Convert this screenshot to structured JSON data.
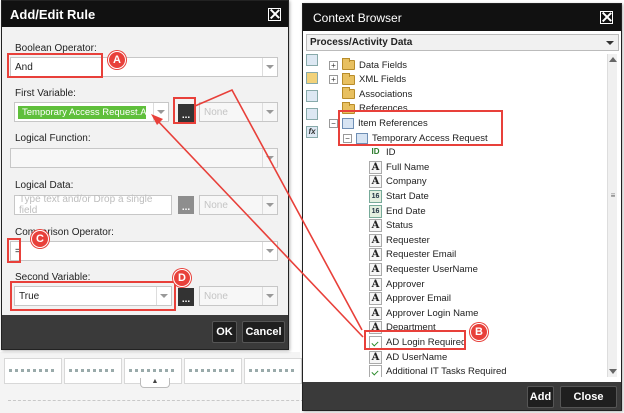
{
  "rule_dialog": {
    "title": "Add/Edit Rule",
    "boolean_operator": {
      "label": "Boolean Operator:",
      "value": "And"
    },
    "first_variable": {
      "label": "First Variable:",
      "value": "Temporary Access Request.AD L",
      "dots": "...",
      "type_value": "None"
    },
    "logical_function": {
      "label": "Logical Function:",
      "value": ""
    },
    "logical_data": {
      "label": "Logical Data:",
      "placeholder": "Type text and/or Drop a single field",
      "dots": "...",
      "type_value": "None"
    },
    "comparison_operator": {
      "label": "Comparison Operator:",
      "value": "="
    },
    "second_variable": {
      "label": "Second Variable:",
      "value": "True",
      "dots": "...",
      "type_value": "None"
    },
    "ok_label": "OK",
    "cancel_label": "Cancel"
  },
  "context_browser": {
    "title": "Context Browser",
    "dropdown_value": "Process/Activity Data",
    "tree": [
      {
        "label": "Data Fields",
        "icon": "folder-icon",
        "expander": "+"
      },
      {
        "label": "XML Fields",
        "icon": "folder-icon",
        "expander": "+"
      },
      {
        "label": "Associations",
        "icon": "folder-icon",
        "expander": ""
      },
      {
        "label": "References",
        "icon": "folder-icon",
        "expander": ""
      },
      {
        "label": "Item References",
        "icon": "item-references-icon",
        "expander": "−"
      },
      {
        "label": "Temporary Access Request",
        "icon": "object-icon",
        "expander": "−"
      },
      {
        "label": "ID",
        "icon": "id-field-icon",
        "expander": ""
      },
      {
        "label": "Full Name",
        "icon": "text-field-icon",
        "expander": ""
      },
      {
        "label": "Company",
        "icon": "text-field-icon",
        "expander": ""
      },
      {
        "label": "Start Date",
        "icon": "date-field-icon",
        "expander": ""
      },
      {
        "label": "End Date",
        "icon": "date-field-icon",
        "expander": ""
      },
      {
        "label": "Status",
        "icon": "text-field-icon",
        "expander": ""
      },
      {
        "label": "Requester",
        "icon": "text-field-icon",
        "expander": ""
      },
      {
        "label": "Requester Email",
        "icon": "text-field-icon",
        "expander": ""
      },
      {
        "label": "Requester UserName",
        "icon": "text-field-icon",
        "expander": ""
      },
      {
        "label": "Approver",
        "icon": "text-field-icon",
        "expander": ""
      },
      {
        "label": "Approver Email",
        "icon": "text-field-icon",
        "expander": ""
      },
      {
        "label": "Approver Login Name",
        "icon": "text-field-icon",
        "expander": ""
      },
      {
        "label": "Department",
        "icon": "text-field-icon",
        "expander": ""
      },
      {
        "label": "AD Login Required",
        "icon": "boolean-field-icon",
        "expander": ""
      },
      {
        "label": "AD UserName",
        "icon": "text-field-icon",
        "expander": ""
      },
      {
        "label": "Additional IT Tasks Required",
        "icon": "boolean-field-icon",
        "expander": ""
      }
    ],
    "date_icon_text": "16",
    "text_icon_text": "A",
    "id_icon_text": "ID",
    "fx_icon_text": "fx",
    "add_label": "Add",
    "close_label": "Close"
  },
  "annotations": {
    "a": "A",
    "b": "B",
    "c": "C",
    "d": "D"
  },
  "colors": {
    "annotation_red": "#e8403a",
    "variable_chip_green": "#5fbf3b",
    "title_bar": "#111111"
  }
}
